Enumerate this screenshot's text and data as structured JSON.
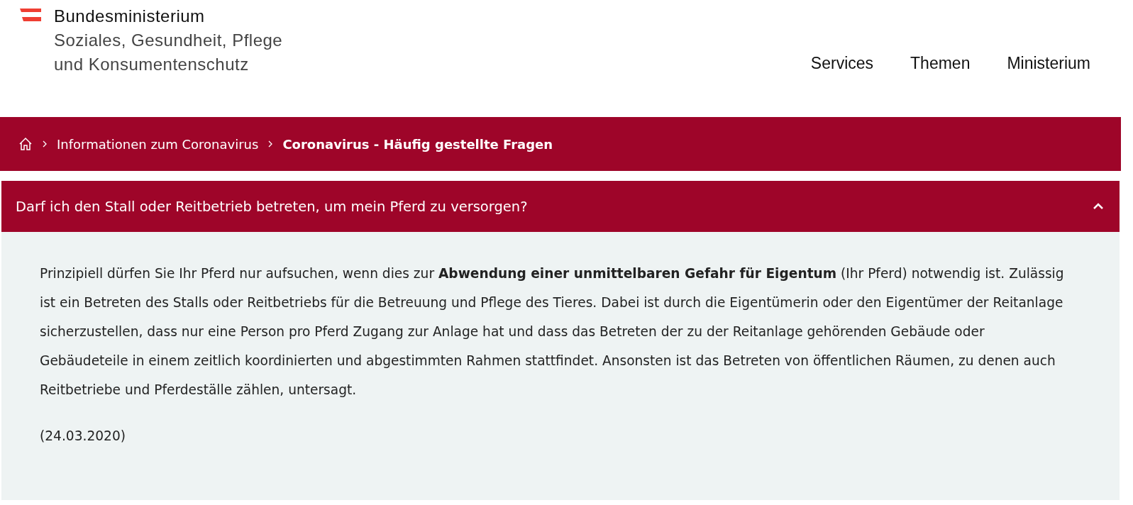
{
  "header": {
    "logo_lines": [
      "Bundesministerium",
      "Soziales, Gesundheit, Pflege",
      "und Konsumentenschutz"
    ],
    "nav": [
      {
        "label": "Services"
      },
      {
        "label": "Themen"
      },
      {
        "label": "Ministerium"
      }
    ]
  },
  "breadcrumb": [
    {
      "label": "Informationen zum Coronavirus",
      "current": false
    },
    {
      "label": "Coronavirus - Häufig gestellte Fragen",
      "current": true
    }
  ],
  "faq": {
    "question": "Darf ich den Stall oder Reitbetrieb betreten, um mein Pferd zu versorgen?",
    "expanded": true,
    "paragraphs": [
      "Prinzipiell dürfen Sie Ihr Pferd nur aufsuchen, wenn dies zur **Abwendung einer unmittelbaren Gefahr für Eigentum** (Ihr Pferd) notwendig ist. Zulässig ist ein Betreten des Stalls oder Reitbetriebs für die Betreuung und Pflege des Tieres. Dabei ist durch die Eigentümerin oder den Eigentümer der Reitanlage sicherzustellen, dass nur eine Person pro Pferd Zugang zur Anlage hat und dass das Betreten der zu der Reitanlage gehörenden Gebäude oder Gebäudeteile in einem zeitlich koordinierten und abgestimmten Rahmen stattfindet. Ansonsten ist das Betreten von öffentlichen Räumen, zu denen auch Reitbetriebe und Pferdeställe zählen, untersagt.",
      "(24.03.2020)"
    ]
  }
}
